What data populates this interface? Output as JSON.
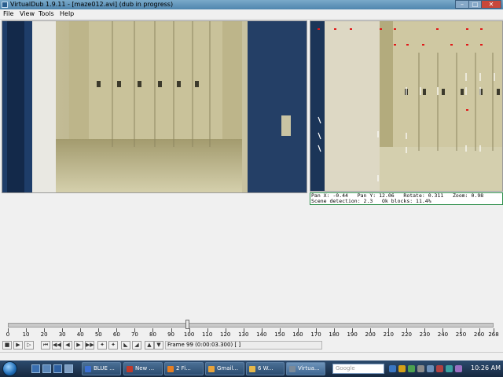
{
  "window": {
    "title": "VirtualDub 1.9.11 - [maze012.avi] (dub in progress)",
    "buttons": {
      "minimize": "–",
      "maximize": "□",
      "close": "✕"
    }
  },
  "menu": [
    "File",
    "View",
    "Tools",
    "Help"
  ],
  "stats": {
    "line1": "Pan X: -0.44   Pan Y: 12.06   Rotate: 0.311   Zoom: 0.98",
    "line2": "Scene detection: 2.3   Ok blocks: 11.4%"
  },
  "timeline": {
    "ticks": [
      "0",
      "10",
      "20",
      "30",
      "40",
      "50",
      "60",
      "70",
      "80",
      "90",
      "100",
      "110",
      "120",
      "130",
      "140",
      "150",
      "160",
      "170",
      "180",
      "190",
      "200",
      "210",
      "220",
      "230",
      "240",
      "250",
      "260",
      "268"
    ],
    "current_frame": 99,
    "total_frames": 268
  },
  "toolbar": {
    "icons": [
      "stop-icon",
      "play-input-icon",
      "play-output-icon",
      "start-icon",
      "prev-key-icon",
      "prev-frame-icon",
      "next-frame-icon",
      "next-key-icon",
      "end-icon",
      "scene-back-icon",
      "scene-forward-icon",
      "mark-in-icon",
      "mark-out-icon",
      "prev-drop-icon",
      "next-drop-icon"
    ],
    "frame_status": "Frame 99 (0:00:03.300) [ ]"
  },
  "taskbar": {
    "tasks": [
      {
        "label": "BLUE ...",
        "color": "#3b6fd1"
      },
      {
        "label": "New ...",
        "color": "#c0392b"
      },
      {
        "label": "2 Fi...",
        "color": "#e67e22"
      },
      {
        "label": "Gmail...",
        "color": "#e8a33a"
      },
      {
        "label": "6 W...",
        "color": "#e6b84a"
      },
      {
        "label": "Virtua...",
        "color": "#7b8a99"
      }
    ],
    "search_placeholder": "Google",
    "clock": "10:26 AM"
  }
}
